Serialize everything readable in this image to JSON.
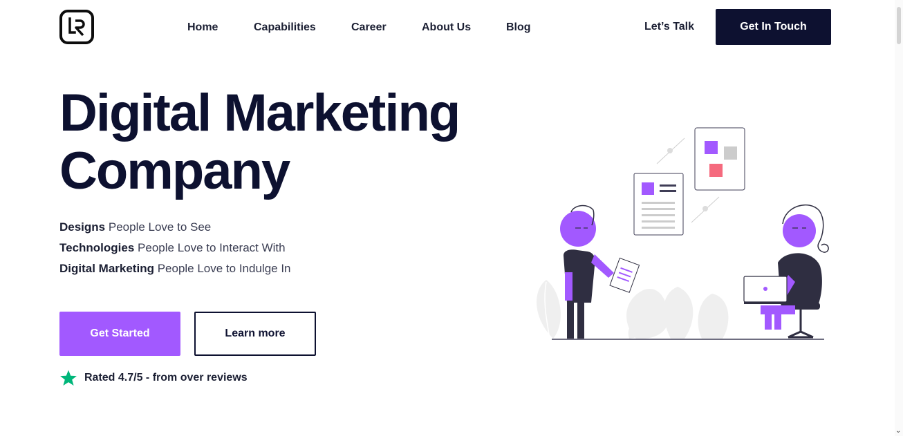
{
  "header": {
    "logo_text": "LR",
    "nav": [
      {
        "label": "Home"
      },
      {
        "label": "Capabilities"
      },
      {
        "label": "Career"
      },
      {
        "label": "About Us"
      },
      {
        "label": "Blog"
      }
    ],
    "lets_talk": "Let’s Talk",
    "cta": "Get In Touch"
  },
  "hero": {
    "title_line1": "Digital Marketing",
    "title_line2": "Company",
    "taglines": [
      {
        "bold": "Designs",
        "rest": " People Love to See"
      },
      {
        "bold": "Technologies",
        "rest": " People Love to Interact With"
      },
      {
        "bold": "Digital Marketing",
        "rest": " People Love to Indulge In"
      }
    ],
    "primary_button": "Get Started",
    "secondary_button": "Learn more",
    "rating_text": "Rated 4.7/5 - from over reviews"
  },
  "colors": {
    "accent": "#a259ff",
    "dark": "#0d1130",
    "star": "#00b67a",
    "pink": "#f56a7e"
  },
  "icons": {
    "star": "star-icon",
    "scroll_down": "chevron-down-icon"
  }
}
